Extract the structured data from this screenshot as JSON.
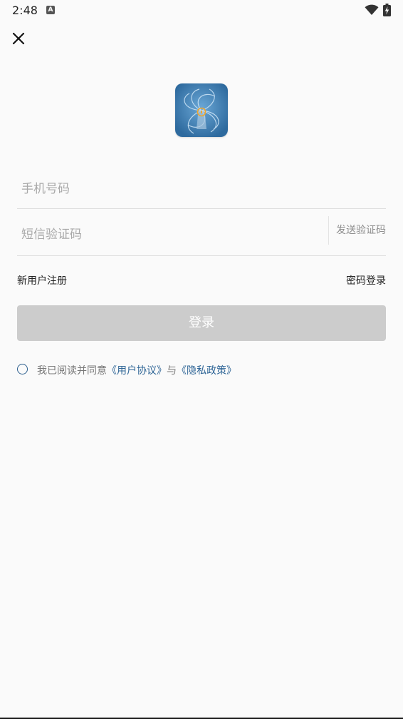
{
  "status_bar": {
    "time": "2:48",
    "notification_icon": "A"
  },
  "login": {
    "phone_placeholder": "手机号码",
    "phone_value": "",
    "sms_placeholder": "短信验证码",
    "sms_value": "",
    "send_code_label": "发送验证码",
    "register_label": "新用户注册",
    "password_login_label": "密码登录",
    "login_button_label": "登录"
  },
  "agreement": {
    "prefix": "我已阅读并同意",
    "user_agreement": "《用户协议》",
    "connector": "与",
    "privacy_policy": "《隐私政策》",
    "checked": false
  },
  "icons": {
    "close": "close-icon",
    "logo": "app-logo",
    "wifi": "wifi-icon",
    "battery": "battery-icon"
  },
  "colors": {
    "background": "#fafafa",
    "link": "#2e6596",
    "disabled_button": "#cccccc",
    "placeholder": "#a9a9a9"
  }
}
